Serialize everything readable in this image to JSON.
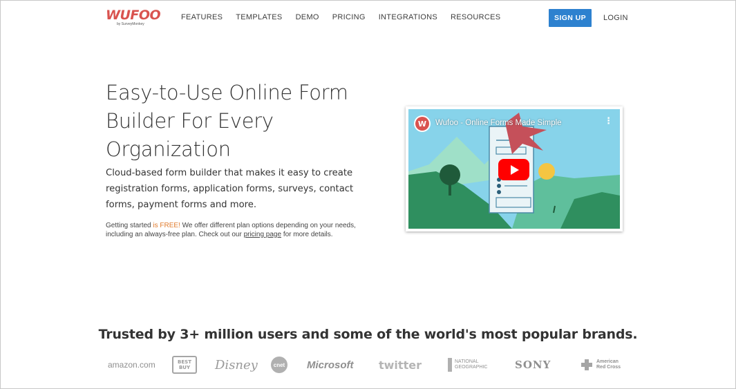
{
  "header": {
    "logo_text": "WUFOO",
    "logo_sub": "by SurveyMonkey",
    "nav": [
      "FEATURES",
      "TEMPLATES",
      "DEMO",
      "PRICING",
      "INTEGRATIONS",
      "RESOURCES"
    ],
    "signup_label": "SIGN UP",
    "login_label": "LOGIN"
  },
  "hero": {
    "headline": "Easy-to-Use Online Form Builder For Every Organization",
    "subhead": "Cloud-based form builder that makes it easy to create registration forms, application forms, surveys, contact forms, payment forms and more.",
    "note_prefix": "Getting started ",
    "note_free": "is FREE!",
    "note_mid": " We offer different plan options depending on your needs, including an always-free plan. Check out our ",
    "note_link": "pricing page",
    "note_suffix": " for more details."
  },
  "video": {
    "title": "Wufoo - Online Forms Made Simple",
    "logo_letter": "W",
    "menu_icon": "⋮"
  },
  "trusted": {
    "heading": "Trusted by 3+ million users and some of the world's most popular brands.",
    "brands": [
      "amazon.com",
      "BEST BUY",
      "Disney",
      "cnet",
      "Microsoft",
      "twitter",
      "NATIONAL GEOGRAPHIC",
      "SONY",
      "American Red Cross"
    ]
  },
  "colors": {
    "accent": "#2d81cf",
    "logo": "#d9534f",
    "free_text": "#e07a2b",
    "play": "#ff0000"
  }
}
